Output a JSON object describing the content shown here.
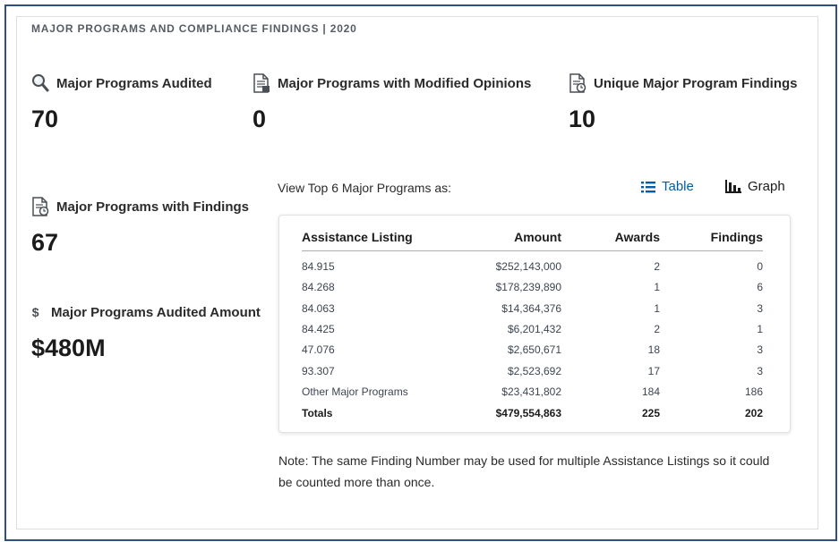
{
  "section_title": "MAJOR PROGRAMS AND COMPLIANCE FINDINGS | 2020",
  "stats": {
    "audited": {
      "label": "Major Programs Audited",
      "value": "70",
      "icon": "magnifier-icon"
    },
    "modified": {
      "label": "Major Programs with Modified Opinions",
      "value": "0",
      "icon": "document-icon"
    },
    "unique": {
      "label": "Unique Major Program Findings",
      "value": "10",
      "icon": "document-clock-icon"
    },
    "with_findings": {
      "label": "Major Programs with Findings",
      "value": "67",
      "icon": "document-clock-icon"
    },
    "amount": {
      "label": "Major Programs Audited Amount",
      "value": "$480M",
      "icon": "dollar-icon"
    }
  },
  "view": {
    "label": "View Top 6 Major Programs as:",
    "table_label": "Table",
    "graph_label": "Graph",
    "table_icon": "list-icon",
    "graph_icon": "bar-chart-icon",
    "active": "Table"
  },
  "table": {
    "headers": [
      "Assistance Listing",
      "Amount",
      "Awards",
      "Findings"
    ],
    "rows": [
      [
        "84.915",
        "$252,143,000",
        "2",
        "0"
      ],
      [
        "84.268",
        "$178,239,890",
        "1",
        "6"
      ],
      [
        "84.063",
        "$14,364,376",
        "1",
        "3"
      ],
      [
        "84.425",
        "$6,201,432",
        "2",
        "1"
      ],
      [
        "47.076",
        "$2,650,671",
        "18",
        "3"
      ],
      [
        "93.307",
        "$2,523,692",
        "17",
        "3"
      ],
      [
        "Other Major Programs",
        "$23,431,802",
        "184",
        "186"
      ]
    ],
    "totals": [
      "Totals",
      "$479,554,863",
      "225",
      "202"
    ]
  },
  "note": "Note: The same Finding Number may be used for multiple Assistance Listings so it could be counted more than once.",
  "colors": {
    "accent": "#005ea2",
    "frame": "#2f4f7f",
    "text": "#1b1b1b",
    "muted": "#565c65"
  }
}
